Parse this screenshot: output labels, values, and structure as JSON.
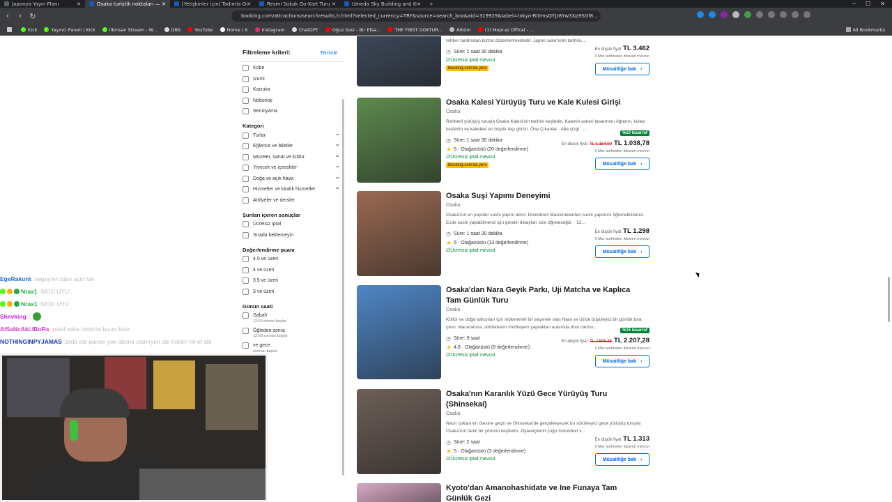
{
  "browser": {
    "tabs": [
      {
        "label": "Japonya Yayın Planı",
        "active": false,
        "fav_color": "#5f6368"
      },
      {
        "label": "Osaka turistik noktaları — Booki",
        "active": true,
        "fav_color": "#1a5bb5"
      },
      {
        "label": "[Yetişkinler için] Tadımla Gelenek",
        "active": false,
        "fav_color": "#1a5bb5"
      },
      {
        "label": "Resmi Sokak Go-Kart Turu - Osaka M",
        "active": false,
        "fav_color": "#1a5bb5"
      },
      {
        "label": "Umeda Sky Building and Kuchu Telen",
        "active": false,
        "fav_color": "#1a5bb5"
      }
    ],
    "new_tab": "+",
    "url": "booking.com/attractions/searchresults.tr.html?selected_currency=TRY&source=search_box&aid=319929&label=tokyo-Rl0msQYjz8Yw3Xp9SGf8...",
    "bookmarks": [
      {
        "label": "Kick",
        "color": "#53fc18"
      },
      {
        "label": "Yayıncı Paneli | Kick",
        "color": "#53fc18"
      },
      {
        "label": "ilkinsan Stream - W...",
        "color": "#53fc18"
      },
      {
        "label": "OBS",
        "color": "#ddd"
      },
      {
        "label": "YouTube",
        "color": "#ff0000"
      },
      {
        "label": "Home / X",
        "color": "#fff"
      },
      {
        "label": "Instagram",
        "color": "#e1306c"
      },
      {
        "label": "ChatGPT",
        "color": "#ddd"
      },
      {
        "label": "Oğuz Sasi - Bir Efsa...",
        "color": "#ff0000"
      },
      {
        "label": "THE FIRST GOKTUR...",
        "color": "#ff0000"
      },
      {
        "label": "Albüm",
        "color": "#bbb"
      },
      {
        "label": "(1) Mepraz Offical - ...",
        "color": "#ff0000"
      }
    ],
    "all_bookmarks": "All Bookmarks"
  },
  "filters": {
    "header": "Filtreleme kriteri:",
    "clear": "Temizle",
    "districts": [
      "Kobe",
      "Izumi",
      "Kaizuka",
      "Noborioji",
      "Senniyama"
    ],
    "category_title": "Kategori",
    "categories": [
      {
        "label": "Turlar",
        "chevron": true
      },
      {
        "label": "Eğlence ve biletler",
        "chevron": true
      },
      {
        "label": "Müzeler, sanat ve kültür",
        "chevron": true
      },
      {
        "label": "Yiyecek ve içecekler",
        "chevron": true
      },
      {
        "label": "Doğa ve açık hava",
        "chevron": true
      },
      {
        "label": "Hizmetler ve kiralık hizmetler",
        "chevron": true
      },
      {
        "label": "Atölyeler ve dersler",
        "chevron": false
      }
    ],
    "conditions_title": "Şunları içeren sonuçlar",
    "conditions": [
      "Ücretsiz iptal",
      "Sırada beklemeyin"
    ],
    "rating_title": "Değerlendirme puanı",
    "ratings": [
      "4.5 ve üzeri",
      "4 ve üzeri",
      "3.5 ve üzeri",
      "3 ve üzeri"
    ],
    "time_title": "Günün saati",
    "times": [
      {
        "label": "Sabah",
        "sub": "12:00 öncesi başlar"
      },
      {
        "label": "Öğleden sonra",
        "sub": "12:00 sonrası başlar"
      },
      {
        "label": "ve gece",
        "sub": "sonrası başlar"
      }
    ]
  },
  "results": [
    {
      "title": "",
      "location": "",
      "description": "Bu oturum, Osaka'daki bir sake fabrikasında bir yıl boyunca eğitim almış belli bir sake üreticisi olan rehber tarafından bizzat düzenlenmektedir. Japon sake'sinin tarihini,...",
      "duration": "Süre: 1 saat 30 dakika",
      "rating": "",
      "cancel": "Ücretsiz iptal mevcut",
      "new_badge": "Booking.com'da yeni",
      "discount": "",
      "price_label": "En düşük fiyat",
      "old_price": "",
      "price": "TL 3.462",
      "since": "9 Mar tarihinden itibaren mevcut",
      "button": "Müsaitliğe bak",
      "img_color": "#3d4a5c"
    },
    {
      "title": "Osaka Kalesi Yürüyüş Turu ve Kale Kulesi Girişi",
      "location": "Osaka",
      "description": "Rehberli yürüyüş turuyla Osaka Kalesi'nin tarihini keşfedin. Kalenin askeri tasarımını öğrenin, kuleyi keşfedin ve kaledeki en büyük taşı görün. Öne Çıkanlar · Atla çizgi · ...",
      "duration": "Süre: 1 saat 30 dakika",
      "rating": "5 · Olağanüstü (20 değerlendirme)",
      "cancel": "Ücretsiz iptal mevcut",
      "new_badge": "Booking.com'da yeni",
      "discount": "%10 tasarruf",
      "price_label": "En düşük fiyat",
      "old_price": "TL 1.154,00",
      "price": "TL 1.038,78",
      "since": "9 Mar tarihinden itibaren mevcut",
      "button": "Müsaitliğe bak",
      "img_color": "#5d8a4e"
    },
    {
      "title": "Osaka Suşi Yapımı Deneyimi",
      "location": "Osaka",
      "description": "Osaka'nın en popüler sushi yapım dersi: Dotonbori! Malzemelerden sushi yapımını öğrenebilirsiniz. Evde sushi yapabilmeniz için gerekli detayları size öğreteceğiz. · 12...",
      "duration": "Süre: 1 saat 30 dakika",
      "rating": "5 · Olağanüstü (13 değerlendirme)",
      "cancel": "Ücretsiz iptal mevcut",
      "new_badge": "",
      "discount": "",
      "price_label": "En düşük fiyat",
      "old_price": "",
      "price": "TL 1.298",
      "since": "9 Mar tarihinden itibaren mevcut",
      "button": "Müsaitliğe bak",
      "img_color": "#9a6a52"
    },
    {
      "title": "Osaka'dan Nara Geyik Parkı, Uji Matcha ve Kaplıca Tam Günlük Turu",
      "location": "Osaka",
      "description": "Kültür ve doğa tutkunları için mükemmel bir seçenek olan Nara ve Uji'de büyüleyici bir günlük tura çıkın. Maceranıza, sonbaharın muhteşem yaprakları arasında dost canlısı...",
      "duration": "Süre: 9 saat",
      "rating": "4,8 · Olağanüstü (8 değerlendirme)",
      "cancel": "Ücretsiz iptal mevcut",
      "new_badge": "",
      "discount": "%15 tasarruf",
      "price_label": "En düşük fiyat",
      "old_price": "TL 2.596,35",
      "price": "TL 2.207,28",
      "since": "9 Mar tarihinden itibaren mevcut",
      "button": "Müsaitliğe bak",
      "img_color": "#4f86c6"
    },
    {
      "title": "Osaka'nın Karanlık Yüzü Gece Yürüyüş Turu (Shinsekai)",
      "location": "Osaka",
      "description": "Neon ışıklarının ötesine geçin ve Shinsekai'de gerçekleşecek bu sürükleyici gece yürüyüş turuyla Osaka'nın farklı bir yönünü keşfedin. Ziyaretçilerin çoğu Dotonbori v...",
      "duration": "Süre: 2 saat",
      "rating": "5 · Olağanüstü (3 değerlendirme)",
      "cancel": "Ücretsiz iptal mevcut",
      "new_badge": "",
      "discount": "",
      "price_label": "En düşük fiyat",
      "old_price": "",
      "price": "TL 1.313",
      "since": "9 Mar tarihinden itibaren mevcut",
      "button": "Müsaitliğe bak",
      "img_color": "#6e5f58"
    },
    {
      "title": "Kyoto'dan Amanohashidate ve Ine Funaya Tam Günlük Gezi",
      "location": "",
      "description": "",
      "duration": "",
      "rating": "",
      "cancel": "",
      "new_badge": "",
      "discount": "",
      "price_label": "",
      "old_price": "",
      "price": "",
      "since": "",
      "button": "",
      "img_color": "#d9a8c4"
    }
  ],
  "chat": [
    {
      "user": "EgeRakunt",
      "color": "#1e6be0",
      "text": "vegaynın banı açın lan",
      "badges": []
    },
    {
      "user": "Nrax1",
      "color": "#2aa84a",
      "text": "MOD UYU",
      "badges": [
        "#53fc18",
        "#f5b400",
        "#2aa84a"
      ]
    },
    {
      "user": "Nrax1",
      "color": "#2aa84a",
      "text": "MOD UYU",
      "badges": [
        "#53fc18",
        "#f5b400",
        "#2aa84a"
      ]
    },
    {
      "user": "Shevking",
      "color": "#c222d8",
      "text": "",
      "badges": [],
      "emote": true
    },
    {
      "user": "AlSaNcAkLIBoRa",
      "color": "#d438c9",
      "text": "pasif sake üreticisi lazım bize",
      "badges": []
    },
    {
      "user": "NOTHINGINPYJAMAS",
      "color": "#1a3aa8",
      "text": "arda abi paranı yok abone olamıyım abi haldın hit et abi",
      "badges": []
    }
  ]
}
